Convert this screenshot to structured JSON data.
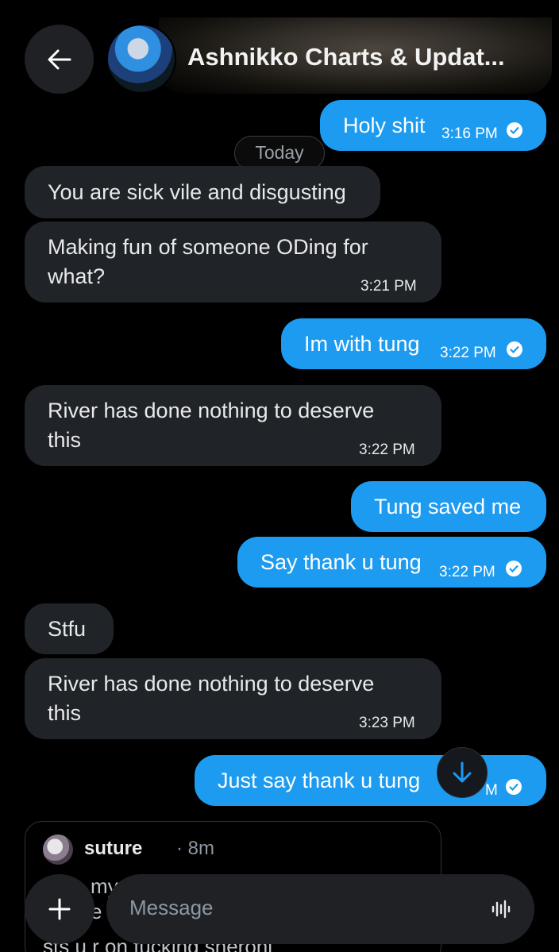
{
  "header": {
    "title": "Ashnikko Charts & Updat..."
  },
  "divider": {
    "label": "Today"
  },
  "messages": [
    {
      "text": "Holy shit",
      "time": "3:16 PM"
    },
    {
      "text": "You are sick vile and disgusting"
    },
    {
      "line1": "Making fun of someone ODing for",
      "line2": "what?",
      "time": "3:21 PM"
    },
    {
      "text": "Im with tung",
      "time": "3:22 PM"
    },
    {
      "line1": "River has done nothing to deserve",
      "line2": "this",
      "time": "3:22 PM"
    },
    {
      "text": "Tung saved me"
    },
    {
      "text": "Say thank u tung",
      "time": "3:22 PM"
    },
    {
      "text": "Stfu"
    },
    {
      "line1": "River has done nothing to deserve",
      "line2": "this",
      "time": "3:23 PM"
    },
    {
      "text": "Just say thank u tung",
      "time": "M"
    }
  ],
  "quoted_post": {
    "author": "suture",
    "time": "· 8m",
    "line1": "my",
    "line2": "e",
    "line3": "sts u r on fucking sheronl"
  },
  "composer": {
    "placeholder": "Message"
  },
  "colors": {
    "outgoing": "#1d9bf0",
    "incoming": "#202327",
    "background": "#000000"
  },
  "icons": [
    "back-arrow-icon",
    "verified-check-icon",
    "scroll-down-arrow-icon",
    "plus-icon",
    "voice-wave-icon"
  ]
}
